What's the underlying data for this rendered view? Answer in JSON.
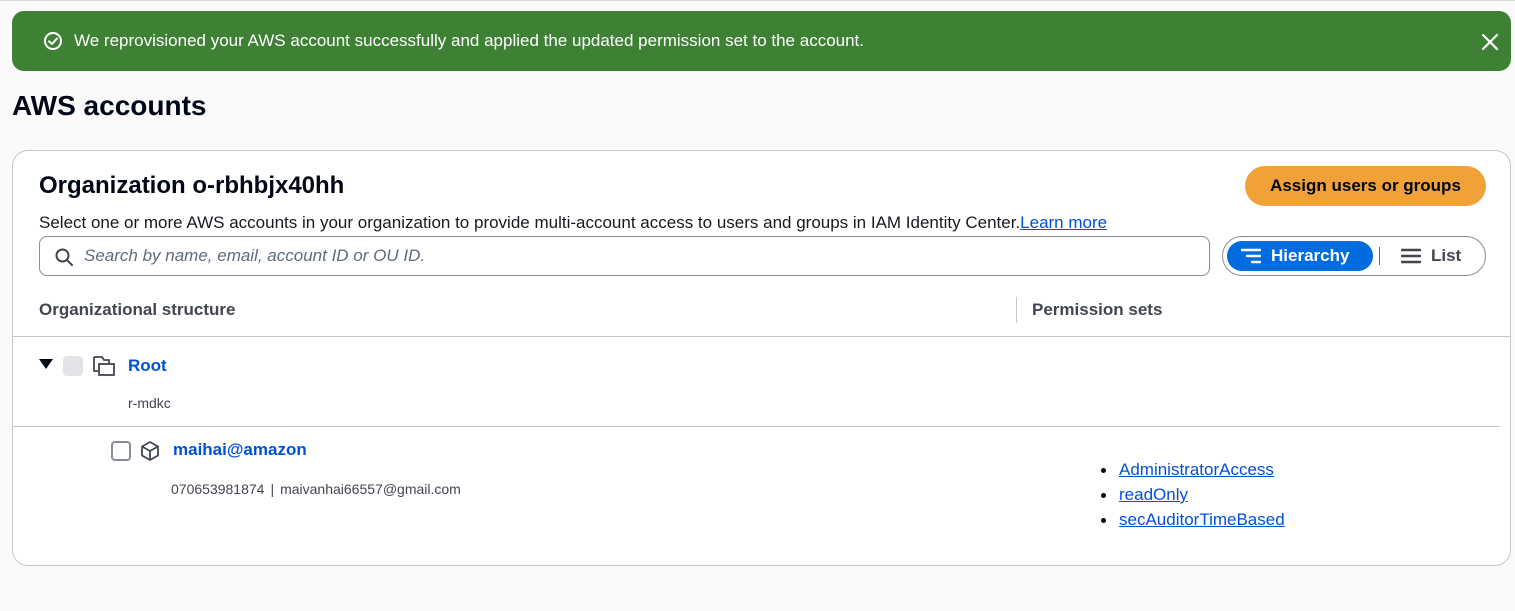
{
  "flash": {
    "message": "We reprovisioned your AWS account successfully and applied the updated permission set to the account.",
    "icon": "check-circle-icon",
    "close_icon": "close-icon",
    "color": "#3e8135"
  },
  "page": {
    "title": "AWS accounts"
  },
  "organization": {
    "title": "Organization o-rbhbjx40hh",
    "assign_button": "Assign users or groups",
    "description": "Select one or more AWS accounts in your organization to provide multi-account access to users and groups in IAM Identity Center.",
    "learn_more": "Learn more",
    "search_placeholder": "Search by name, email, account ID or OU ID.",
    "view_toggle": {
      "hierarchy": "Hierarchy",
      "list": "List",
      "selected": "Hierarchy"
    },
    "columns": {
      "structure": "Organizational structure",
      "permission_sets": "Permission sets"
    },
    "root": {
      "name": "Root",
      "id": "r-mdkc",
      "expanded": true
    },
    "accounts": [
      {
        "name": "maihai@amazon",
        "account_id": "070653981874",
        "separator": "|",
        "email": "maivanhai66557@gmail.com",
        "permission_sets": [
          "AdministratorAccess",
          "readOnly",
          "secAuditorTimeBased"
        ]
      }
    ]
  },
  "colors": {
    "accent": "#006ce0",
    "primary_button": "#f0a138",
    "link": "#0050d8"
  }
}
